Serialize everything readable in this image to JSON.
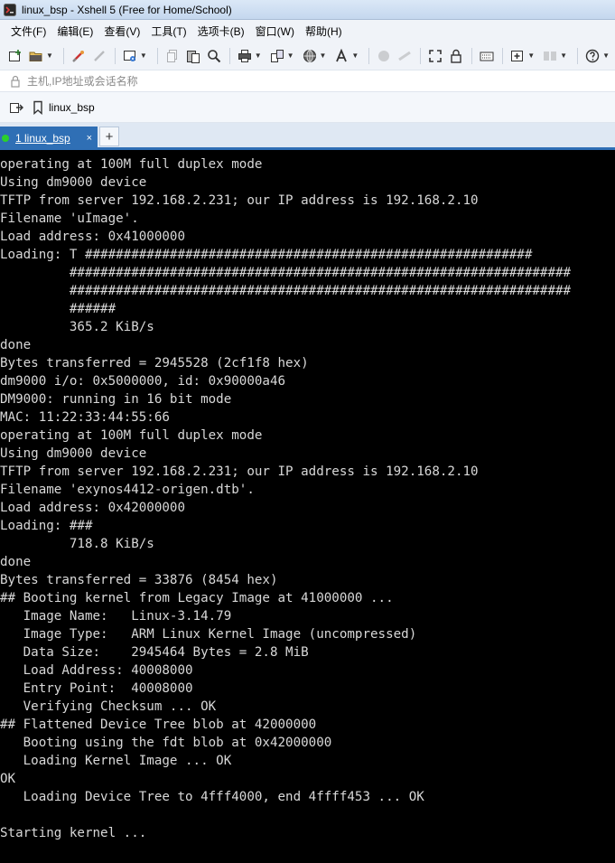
{
  "window": {
    "title": "linux_bsp - Xshell 5 (Free for Home/School)"
  },
  "menu": {
    "items": [
      "文件(F)",
      "编辑(E)",
      "查看(V)",
      "工具(T)",
      "选项卡(B)",
      "窗口(W)",
      "帮助(H)"
    ]
  },
  "address": {
    "placeholder": "主机,IP地址或会话名称"
  },
  "session_bar": {
    "label": "linux_bsp"
  },
  "tabs": {
    "active_label": "1 linux_bsp",
    "close_glyph": "×",
    "add_glyph": "+"
  },
  "terminal": {
    "lines": [
      "operating at 100M full duplex mode",
      "Using dm9000 device",
      "TFTP from server 192.168.2.231; our IP address is 192.168.2.10",
      "Filename 'uImage'.",
      "Load address: 0x41000000",
      "Loading: T ##########################################################",
      "         #################################################################",
      "         #################################################################",
      "         ######",
      "         365.2 KiB/s",
      "done",
      "Bytes transferred = 2945528 (2cf1f8 hex)",
      "dm9000 i/o: 0x5000000, id: 0x90000a46",
      "DM9000: running in 16 bit mode",
      "MAC: 11:22:33:44:55:66",
      "operating at 100M full duplex mode",
      "Using dm9000 device",
      "TFTP from server 192.168.2.231; our IP address is 192.168.2.10",
      "Filename 'exynos4412-origen.dtb'.",
      "Load address: 0x42000000",
      "Loading: ###",
      "         718.8 KiB/s",
      "done",
      "Bytes transferred = 33876 (8454 hex)",
      "## Booting kernel from Legacy Image at 41000000 ...",
      "   Image Name:   Linux-3.14.79",
      "   Image Type:   ARM Linux Kernel Image (uncompressed)",
      "   Data Size:    2945464 Bytes = 2.8 MiB",
      "   Load Address: 40008000",
      "   Entry Point:  40008000",
      "   Verifying Checksum ... OK",
      "## Flattened Device Tree blob at 42000000",
      "   Booting using the fdt blob at 0x42000000",
      "   Loading Kernel Image ... OK",
      "OK",
      "   Loading Device Tree to 4fff4000, end 4ffff453 ... OK",
      "",
      "Starting kernel ..."
    ]
  },
  "colors": {
    "terminal_bg": "#000000",
    "terminal_fg": "#d8d8d8",
    "tab_active": "#2f6fb5",
    "status_dot": "#2bd12b"
  },
  "icons": {
    "toolbar": [
      "new-session-icon",
      "open-folder-icon",
      "reconnect-icon",
      "properties-icon",
      "copy-icon",
      "paste-icon",
      "find-icon",
      "print-icon",
      "transfer-icon",
      "globe-icon",
      "font-icon",
      "script-icon",
      "record-icon",
      "fullscreen-icon",
      "lock-icon",
      "keyboard-icon",
      "compose-icon",
      "layout-icon",
      "help-icon"
    ]
  }
}
